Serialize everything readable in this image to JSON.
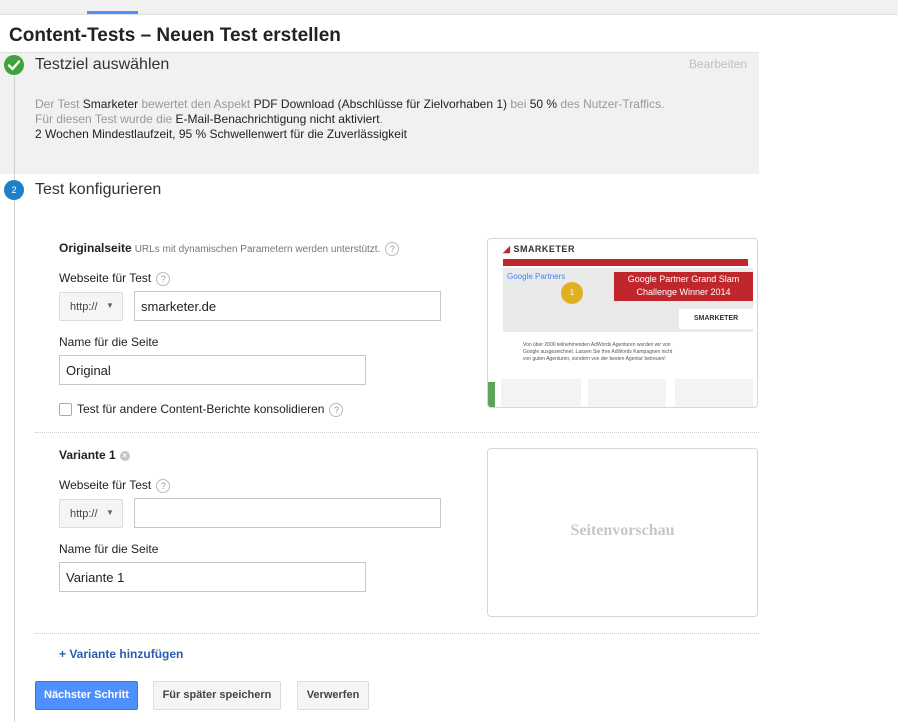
{
  "page": {
    "title": "Content-Tests – Neuen Test erstellen"
  },
  "step1": {
    "number": "1",
    "title": "Testziel auswählen",
    "edit_label": "Bearbeiten",
    "line1": {
      "p1": "Der Test ",
      "h1": "Smarketer",
      "p2": " bewertet den Aspekt ",
      "h2": "PDF Download (Abschlüsse für Zielvorhaben 1)",
      "p3": " bei ",
      "h3": "50 %",
      "p4": " des Nutzer-Traffics."
    },
    "line2": {
      "p1": "Für diesen Test wurde die ",
      "h1": "E-Mail-Benachrichtigung nicht aktiviert",
      "p2": "."
    },
    "line3": "2 Wochen Mindestlaufzeit, 95 % Schwellenwert für die Zuverlässigkeit"
  },
  "step2": {
    "number": "2",
    "title": "Test konfigurieren"
  },
  "original": {
    "heading": "Originalseite",
    "note": "URLs mit dynamischen Parametern werden unterstützt.",
    "url_label": "Webseite für Test",
    "protocol": "http://",
    "url_value": "smarketer.de",
    "name_label": "Name für die Seite",
    "name_value": "Original",
    "consolidate_label": "Test für andere Content-Berichte konsolidieren"
  },
  "preview_site": {
    "logo": "SMARKETER",
    "partner_label": "Google Partners",
    "banner_line1": "Google Partner Grand Slam",
    "banner_line2": "Challenge Winner 2014",
    "trophy_text": "1",
    "body_text": "Von über 2000 teilnehmenden AdWords Agenturen wurden wir von Google ausgezeichnet. Lassen Sie Ihre AdWords Kampagnen nicht von guten Agenturen, sondern von der besten Agentur betreuen!"
  },
  "variant1": {
    "heading": "Variante 1",
    "url_label": "Webseite für Test",
    "protocol": "http://",
    "url_value": "",
    "name_label": "Name für die Seite",
    "name_value": "Variante 1",
    "preview_placeholder": "Seitenvorschau"
  },
  "actions": {
    "add_variant": "+ Variante hinzufügen",
    "next": "Nächster Schritt",
    "save_later": "Für später speichern",
    "discard": "Verwerfen"
  },
  "icons": {
    "check": "check-icon",
    "help": "help-icon",
    "remove": "remove-icon",
    "caret": "caret-down-icon"
  },
  "colors": {
    "primary": "#4d90fe",
    "success": "#40a33c",
    "step_active": "#1e80c7",
    "link": "#2a5db0",
    "brand_red": "#c0272d"
  }
}
